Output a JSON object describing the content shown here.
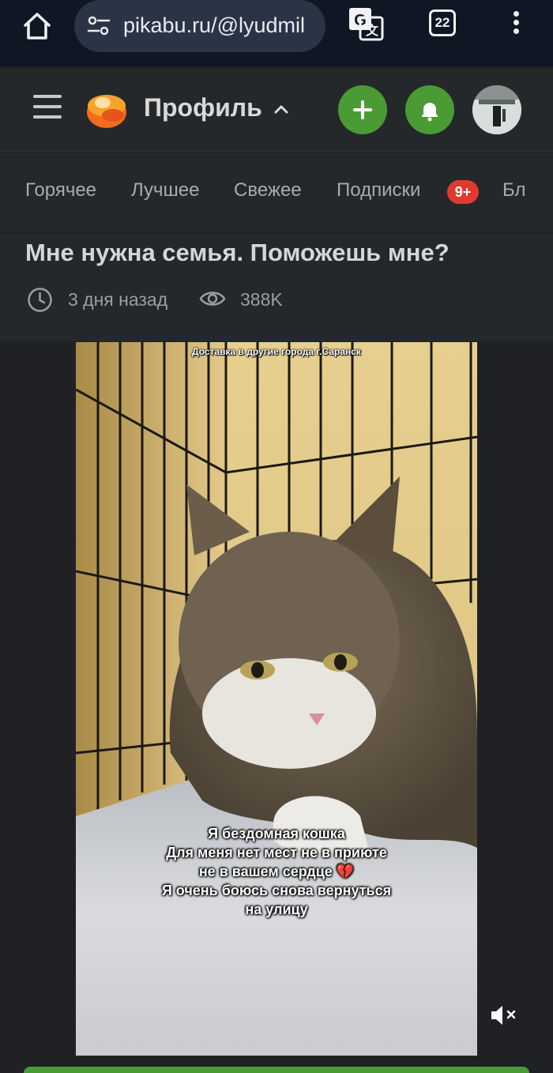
{
  "browser": {
    "url": "pikabu.ru/@lyudmil",
    "tab_count": "22",
    "icons": [
      "home-icon",
      "site-settings-icon",
      "translate-icon",
      "tabs-icon",
      "more-vert-icon"
    ]
  },
  "header": {
    "title": "Профиль",
    "icons": [
      "menu-icon",
      "pikabu-logo",
      "chevron-up-icon",
      "plus-icon",
      "bell-icon",
      "avatar"
    ],
    "accent_color": "#4a9b33"
  },
  "nav": {
    "tabs": [
      {
        "label": "Горячее"
      },
      {
        "label": "Лучшее"
      },
      {
        "label": "Свежее"
      },
      {
        "label": "Подписки"
      },
      {
        "label": "Бл"
      }
    ],
    "subscriptions_badge": "9+",
    "badge_color": "#e03a2e"
  },
  "post": {
    "title": "Мне нужна семья. Поможешь мне?",
    "time": "3 дня назад",
    "views": "388K"
  },
  "video": {
    "top_caption": "Доставка в другие города г.Саранск",
    "caption_lines": [
      "Я бездомная кошка",
      "Для меня нет мест не в приюте",
      "не в вашем сердце 💔",
      "Я очень боюсь снова вернуться",
      "на улицу"
    ],
    "muted": true
  }
}
